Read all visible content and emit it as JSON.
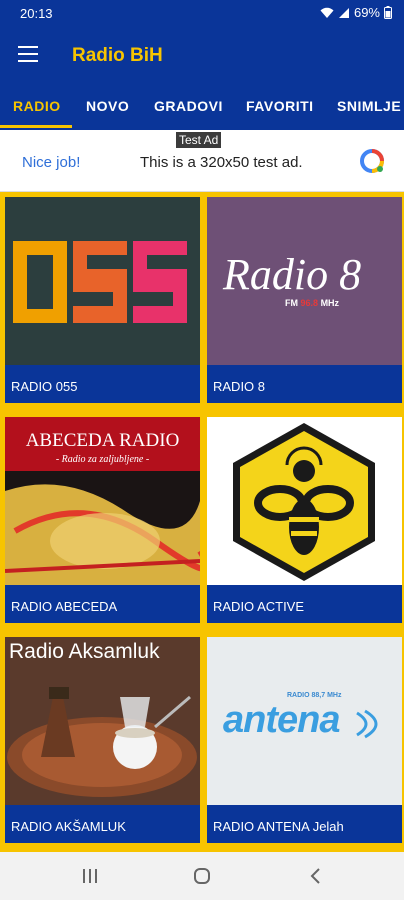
{
  "status_bar": {
    "time": "20:13",
    "battery": "69%"
  },
  "app_bar": {
    "title": "Radio BiH",
    "menu_icon": "hamburger-menu-icon"
  },
  "tabs": [
    {
      "label": "RADIO",
      "active": true
    },
    {
      "label": "NOVO",
      "active": false
    },
    {
      "label": "GRADOVI",
      "active": false
    },
    {
      "label": "FAVORITI",
      "active": false
    },
    {
      "label": "SNIMLJE",
      "active": false
    }
  ],
  "ad": {
    "tag": "Test Ad",
    "cta": "Nice job!",
    "text": "This is a 320x50 test ad."
  },
  "stations": [
    {
      "name": "RADIO 055",
      "logo_text": "055"
    },
    {
      "name": "RADIO 8",
      "logo_text": "Radio 8",
      "logo_sub_fm": "FM",
      "logo_sub_freq": "96.8",
      "logo_sub_mhz": "MHz"
    },
    {
      "name": "RADIO ABECEDA",
      "logo_text": "ABECEDA RADIO",
      "logo_sub": "- Radio za zaljubljene -"
    },
    {
      "name": "RADIO ACTIVE",
      "logo_text": ""
    },
    {
      "name": "RADIO AKŠAMLUK",
      "logo_text": "Radio Aksamluk"
    },
    {
      "name": "RADIO ANTENA Jelah",
      "logo_text": "antena",
      "logo_sub": "RADIO 88,7 MHz"
    }
  ],
  "colors": {
    "primary": "#0a3599",
    "accent": "#f7c400"
  }
}
